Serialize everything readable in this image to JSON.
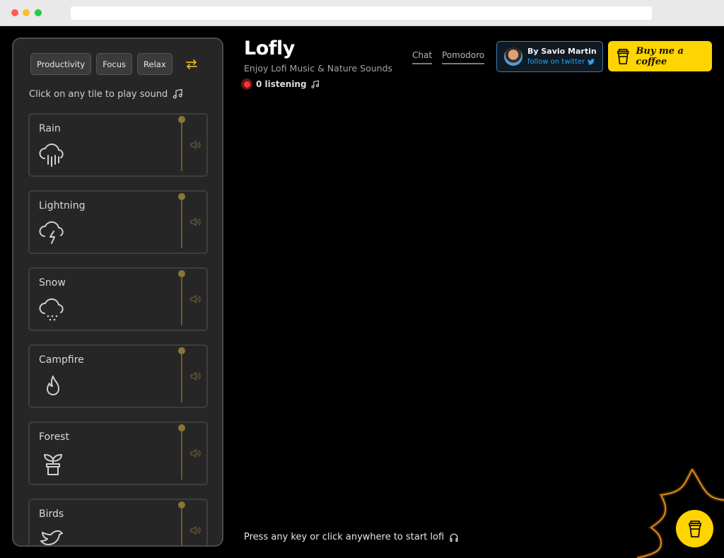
{
  "app": {
    "title": "Lofly",
    "tagline": "Enjoy Lofi Music & Nature Sounds",
    "listening": "0 listening",
    "start_hint": "Press any key or click anywhere to start lofi"
  },
  "nav": {
    "chat": "Chat",
    "pomodoro": "Pomodoro"
  },
  "author": {
    "name": "By Savio Martin",
    "follow": "follow on twitter"
  },
  "coffee": {
    "label": "Buy me a coffee"
  },
  "sidebar": {
    "modes": [
      "Productivity",
      "Focus",
      "Relax"
    ],
    "hint": "Click on any tile to play sound",
    "tiles": [
      {
        "label": "Rain",
        "icon": "rain-cloud-icon"
      },
      {
        "label": "Lightning",
        "icon": "lightning-cloud-icon"
      },
      {
        "label": "Snow",
        "icon": "snow-cloud-icon"
      },
      {
        "label": "Campfire",
        "icon": "flame-icon"
      },
      {
        "label": "Forest",
        "icon": "plant-icon"
      },
      {
        "label": "Birds",
        "icon": "bird-icon"
      }
    ]
  },
  "colors": {
    "accent": "#ffd400",
    "background": "#000000",
    "panel": "#262626",
    "twitter": "#2aa4f0",
    "live": "#ef3b3b"
  }
}
